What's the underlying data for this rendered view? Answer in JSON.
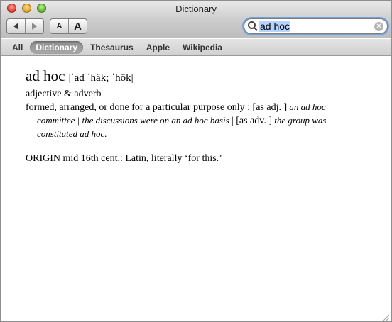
{
  "window": {
    "title": "Dictionary"
  },
  "toolbar": {
    "back_icon": "chevron-left",
    "forward_icon": "chevron-right",
    "font_smaller": "A",
    "font_larger": "A"
  },
  "search": {
    "query": "ad hoc",
    "icon": "magnifier",
    "clear_icon": "circled-x",
    "clear_glyph": "✕"
  },
  "scopes": [
    {
      "label": "All",
      "active": false
    },
    {
      "label": "Dictionary",
      "active": true
    },
    {
      "label": "Thesaurus",
      "active": false
    },
    {
      "label": "Apple",
      "active": false
    },
    {
      "label": "Wikipedia",
      "active": false
    }
  ],
  "entry": {
    "headword": "ad hoc",
    "pronunciation": "|ˈad ˈhäk; ˈhōk|",
    "part_of_speech": "adjective & adverb",
    "definition": "formed, arranged, or done for a particular purpose only : ",
    "gram_adj": "[as adj. ]",
    "example_adj": " an ad hoc committee | the discussions were on an ad hoc basis ",
    "separator": "| ",
    "gram_adv": "[as adv. ]",
    "example_adv": " the group was constituted ad hoc.",
    "origin": "ORIGIN mid 16th cent.: Latin, literally ‘for this.’"
  },
  "colors": {
    "accent_focus_ring": "#6fa2df",
    "selection": "#b5d5ff",
    "close": "#e2382c",
    "minimize": "#e0a124",
    "zoom": "#58b22e"
  }
}
